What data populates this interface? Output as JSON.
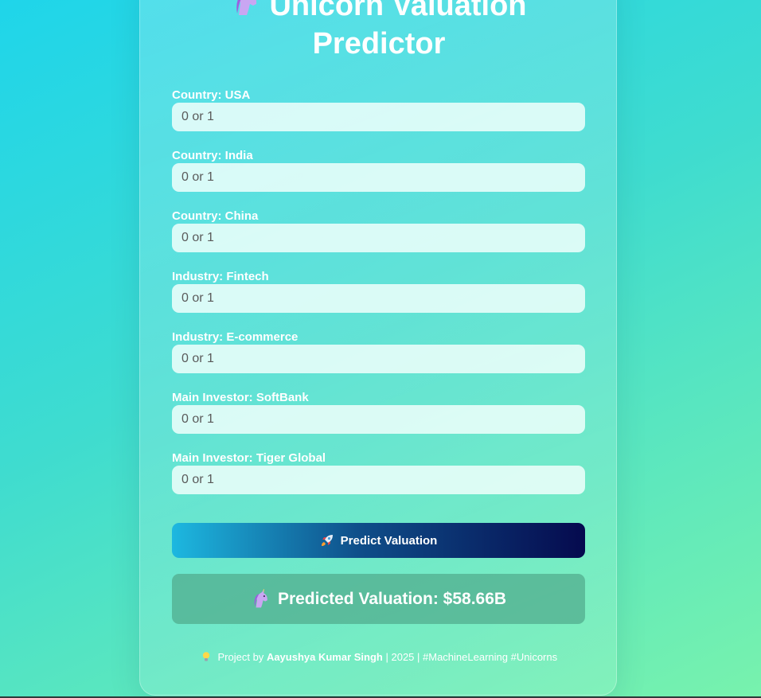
{
  "app": {
    "title_line1": "Unicorn Valuation",
    "title_line2": "Predictor"
  },
  "form": {
    "fields": [
      {
        "label": "Country: USA",
        "placeholder": "0 or 1",
        "value": ""
      },
      {
        "label": "Country: India",
        "placeholder": "0 or 1",
        "value": ""
      },
      {
        "label": "Country: China",
        "placeholder": "0 or 1",
        "value": ""
      },
      {
        "label": "Industry: Fintech",
        "placeholder": "0 or 1",
        "value": ""
      },
      {
        "label": "Industry: E-commerce",
        "placeholder": "0 or 1",
        "value": ""
      },
      {
        "label": "Main Investor: SoftBank",
        "placeholder": "0 or 1",
        "value": ""
      },
      {
        "label": "Main Investor: Tiger Global",
        "placeholder": "0 or 1",
        "value": ""
      }
    ],
    "submit_label": "Predict Valuation",
    "submit_icon": "rocket-icon"
  },
  "result": {
    "text": "Predicted Valuation: $58.66B",
    "icon": "unicorn-icon"
  },
  "footer": {
    "prefix": "Project by",
    "author": "Aayushya Kumar Singh",
    "suffix": "| 2025 | #MachineLearning #Unicorns",
    "icon": "lightbulb-icon"
  },
  "colors": {
    "button_start": "#1db8e0",
    "button_end": "#050a4e",
    "result_bg": "#50aa8c"
  }
}
